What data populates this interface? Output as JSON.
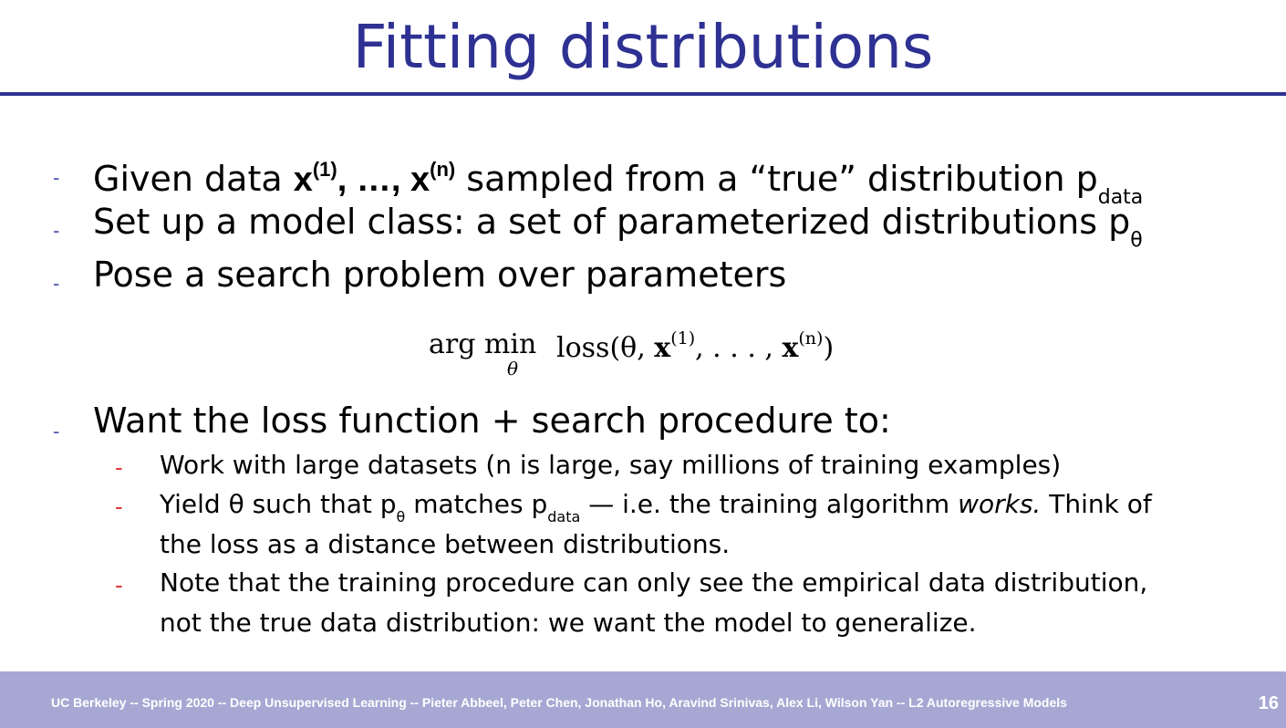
{
  "slide": {
    "title": "Fitting distributions",
    "bullets": [
      {
        "dash": "-",
        "p1": "Given data ",
        "x1": "x",
        "x1_sup": "(1)",
        "mid": ", …, ",
        "xn": "x",
        "xn_sup": "(n)",
        "p2": " sampled from a “true” distribution p",
        "sub": "data"
      },
      {
        "dash": "-",
        "text": "Set up a model class: a set of parameterized distributions p",
        "sub": "θ"
      },
      {
        "dash": "-",
        "text": "Pose a search problem over parameters"
      }
    ],
    "formula": {
      "argmin": "arg min",
      "under": "θ",
      "expr_a": "loss(θ, ",
      "x": "x",
      "sup1": "(1)",
      "expr_b": ", . . . , ",
      "supn": "(n)",
      "expr_c": ")"
    },
    "bullet4": {
      "dash": "-",
      "text": "Want the loss function + search procedure to:"
    },
    "subbullets": [
      {
        "dash": "-",
        "text": "Work with large datasets (n is large, say millions of training examples)"
      },
      {
        "dash": "-",
        "a": "Yield θ such that p",
        "a_sub": "θ",
        "b": " matches p",
        "b_sub": "data",
        "c": " — i.e. the training algorithm ",
        "em": "works.",
        "d": " Think of",
        "line2": "the loss as a distance between distributions."
      },
      {
        "dash": "-",
        "line1": "Note that the training procedure can only see the empirical data distribution,",
        "line2": "not the true data distribution: we want the model to generalize."
      }
    ]
  },
  "footer": {
    "text": "UC Berkeley -- Spring 2020 -- Deep Unsupervised Learning -- Pieter Abbeel, Peter Chen, Jonathan Ho, Aravind Srinivas, Alex Li, Wilson Yan -- L2 Autoregressive Models",
    "page": "16"
  },
  "colors": {
    "title": "#2e3192",
    "dash_main": "#4a56b0",
    "dash_sub": "#e0383e",
    "footer_bg": "#a6a8d3"
  }
}
